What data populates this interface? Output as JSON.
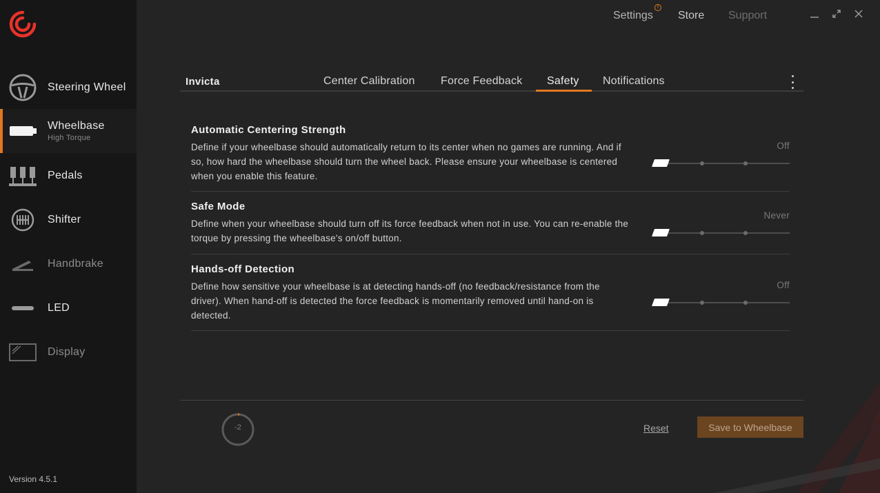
{
  "app": {
    "version": "Version 4.5.1",
    "accent_color": "#e0781e"
  },
  "sidebar": {
    "items": [
      {
        "label": "Steering Wheel",
        "icon": "steering-wheel-icon"
      },
      {
        "label": "Wheelbase",
        "sublabel": "High Torque",
        "icon": "wheelbase-icon",
        "active": true
      },
      {
        "label": "Pedals",
        "icon": "pedals-icon"
      },
      {
        "label": "Shifter",
        "icon": "shifter-icon"
      },
      {
        "label": "Handbrake",
        "icon": "handbrake-icon"
      },
      {
        "label": "LED",
        "icon": "led-icon"
      },
      {
        "label": "Display",
        "icon": "display-icon"
      }
    ]
  },
  "topnav": {
    "settings": "Settings",
    "settings_badge": "!",
    "store": "Store",
    "support": "Support"
  },
  "header": {
    "device_name": "Invicta",
    "tabs": [
      {
        "label": "Center Calibration"
      },
      {
        "label": "Force Feedback"
      },
      {
        "label": "Safety",
        "active": true
      },
      {
        "label": "Notifications"
      }
    ]
  },
  "settings": [
    {
      "title": "Automatic Centering Strength",
      "description": "Define if your wheelbase should automatically return to its center when no games are running. And if so, how hard the wheelbase should turn the wheel back. Please ensure your wheelbase is centered when you enable this feature.",
      "value": "Off",
      "slider_position": 0
    },
    {
      "title": "Safe Mode",
      "description": "Define when your wheelbase should turn off its force feedback when not in use. You can re-enable the torque by pressing the wheelbase's on/off button.",
      "value": "Never",
      "slider_position": 0
    },
    {
      "title": "Hands-off Detection",
      "description": "Define how sensitive your wheelbase is at detecting hands-off (no feedback/resistance from the driver). When hand-off is detected the force feedback is momentarily removed until hand-on is detected.",
      "value": "Off",
      "slider_position": 0
    }
  ],
  "footer": {
    "progress_text": "-2",
    "reset_label": "Reset",
    "save_label": "Save to Wheelbase"
  }
}
